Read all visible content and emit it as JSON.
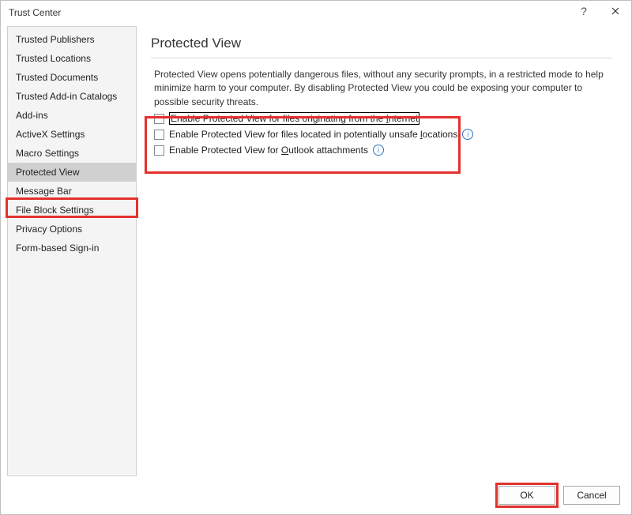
{
  "window": {
    "title": "Trust Center"
  },
  "sidebar": {
    "items": [
      {
        "label": "Trusted Publishers"
      },
      {
        "label": "Trusted Locations"
      },
      {
        "label": "Trusted Documents"
      },
      {
        "label": "Trusted Add-in Catalogs"
      },
      {
        "label": "Add-ins"
      },
      {
        "label": "ActiveX Settings"
      },
      {
        "label": "Macro Settings"
      },
      {
        "label": "Protected View"
      },
      {
        "label": "Message Bar"
      },
      {
        "label": "File Block Settings"
      },
      {
        "label": "Privacy Options"
      },
      {
        "label": "Form-based Sign-in"
      }
    ],
    "selected_index": 7
  },
  "main": {
    "title": "Protected View",
    "description": "Protected View opens potentially dangerous files, without any security prompts, in a restricted mode to help minimize harm to your computer. By disabling Protected View you could be exposing your computer to possible security threats.",
    "checkboxes": [
      {
        "pre": "Enable Protected View for files originating from the ",
        "u": "I",
        "post": "nternet",
        "checked": false,
        "info": false
      },
      {
        "pre": "Enable Protected View for files located in potentially unsafe ",
        "u": "l",
        "post": "ocations",
        "checked": false,
        "info": true
      },
      {
        "pre": "Enable Protected View for ",
        "u": "O",
        "post": "utlook attachments",
        "checked": false,
        "info": true
      }
    ]
  },
  "buttons": {
    "ok": "OK",
    "cancel": "Cancel"
  }
}
